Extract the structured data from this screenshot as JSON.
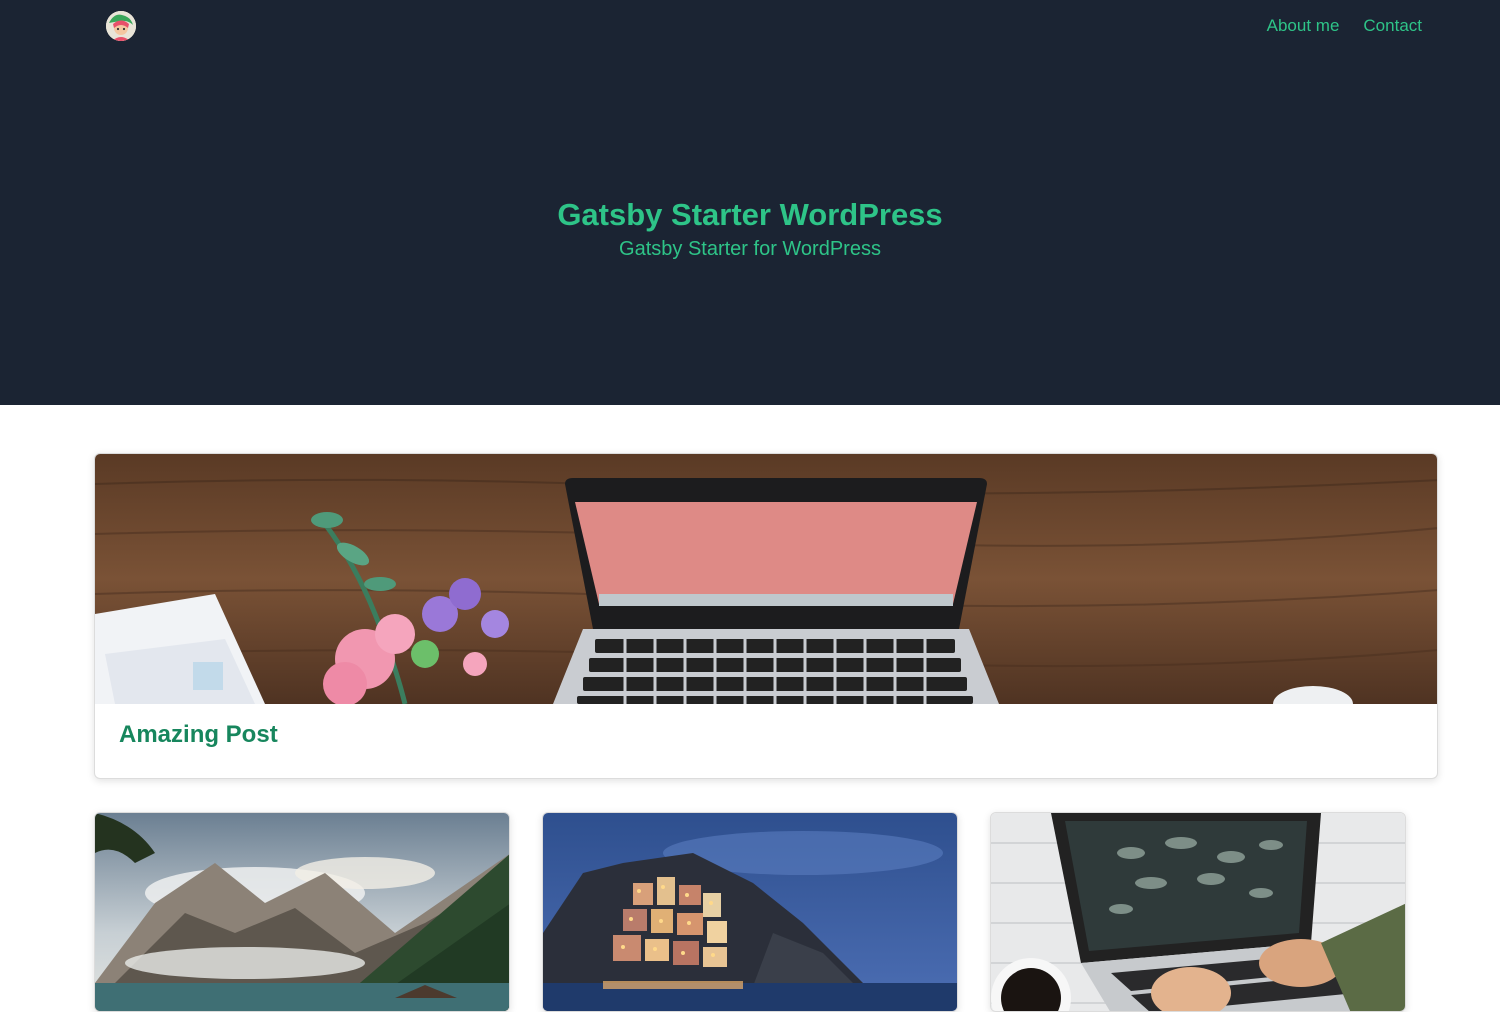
{
  "site": {
    "title": "Gatsby Starter WordPress",
    "subtitle": "Gatsby Starter for WordPress"
  },
  "nav": {
    "logo_icon": "avatar-logo-icon",
    "links": [
      {
        "label": "About me"
      },
      {
        "label": "Contact"
      }
    ]
  },
  "featured_post": {
    "title": "Amazing Post",
    "image": "laptop-flowers-desk-image"
  },
  "posts": [
    {
      "image": "mountain-lake-image"
    },
    {
      "image": "coastal-village-night-image"
    },
    {
      "image": "typing-laptop-coffee-image"
    }
  ],
  "colors": {
    "header_bg": "#1b2433",
    "accent": "#2ec488",
    "post_title": "#17865d"
  }
}
